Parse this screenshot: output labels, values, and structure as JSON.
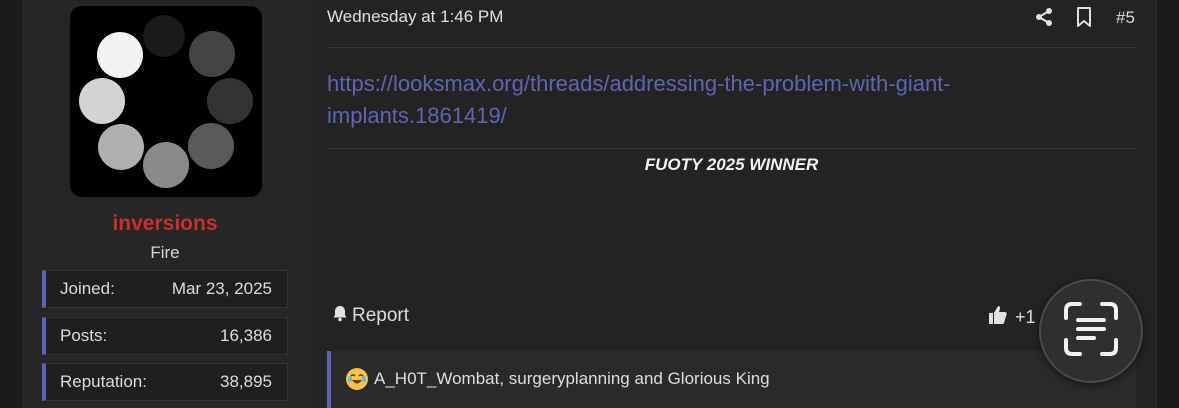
{
  "user": {
    "name": "inversions",
    "title": "Fire",
    "stats": [
      {
        "label": "Joined:",
        "value": "Mar 23, 2025"
      },
      {
        "label": "Posts:",
        "value": "16,386"
      },
      {
        "label": "Reputation:",
        "value": "38,895"
      }
    ],
    "name_color": "#c8302c"
  },
  "post": {
    "date": "Wednesday at 1:46 PM",
    "number": "#5",
    "link_text": "https://looksmax.org/threads/addressing-the-problem-with-giant-implants.1861419/",
    "signature": "FUOTY 2025 WINNER",
    "report_label": "Report",
    "like_count": "+1",
    "reactions_text": "A_H0T_Wombat, surgeryplanning and Glorious King",
    "accent_color": "#5a63b4",
    "link_color": "#5d65b5"
  },
  "icons": {
    "share": "share-icon",
    "bookmark": "bookmark-icon",
    "report": "bell-icon",
    "like": "thumbs-up-icon",
    "reaction": "laughing-crying-emoji-icon",
    "lens": "scan-text-icon"
  }
}
